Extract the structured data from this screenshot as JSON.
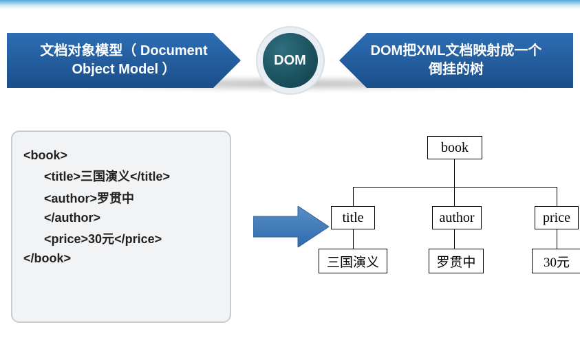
{
  "header": {
    "left_line1": "文档对象模型（ Document",
    "left_line2": "Object Model ）",
    "center": "DOM",
    "right_line1": "DOM把XML文档映射成一个",
    "right_line2": "倒挂的树"
  },
  "code": {
    "l1": "<book>",
    "l2": "<title>三国演义</title>",
    "l3": "<author>罗贯中",
    "l4": "</author>",
    "l5": "<price>30元</price>",
    "l6": "</book>"
  },
  "tree": {
    "root": "book",
    "child1": "title",
    "child2": "author",
    "child3": "price",
    "leaf1": "三国演义",
    "leaf2": "罗贯中",
    "leaf3": "30元"
  }
}
